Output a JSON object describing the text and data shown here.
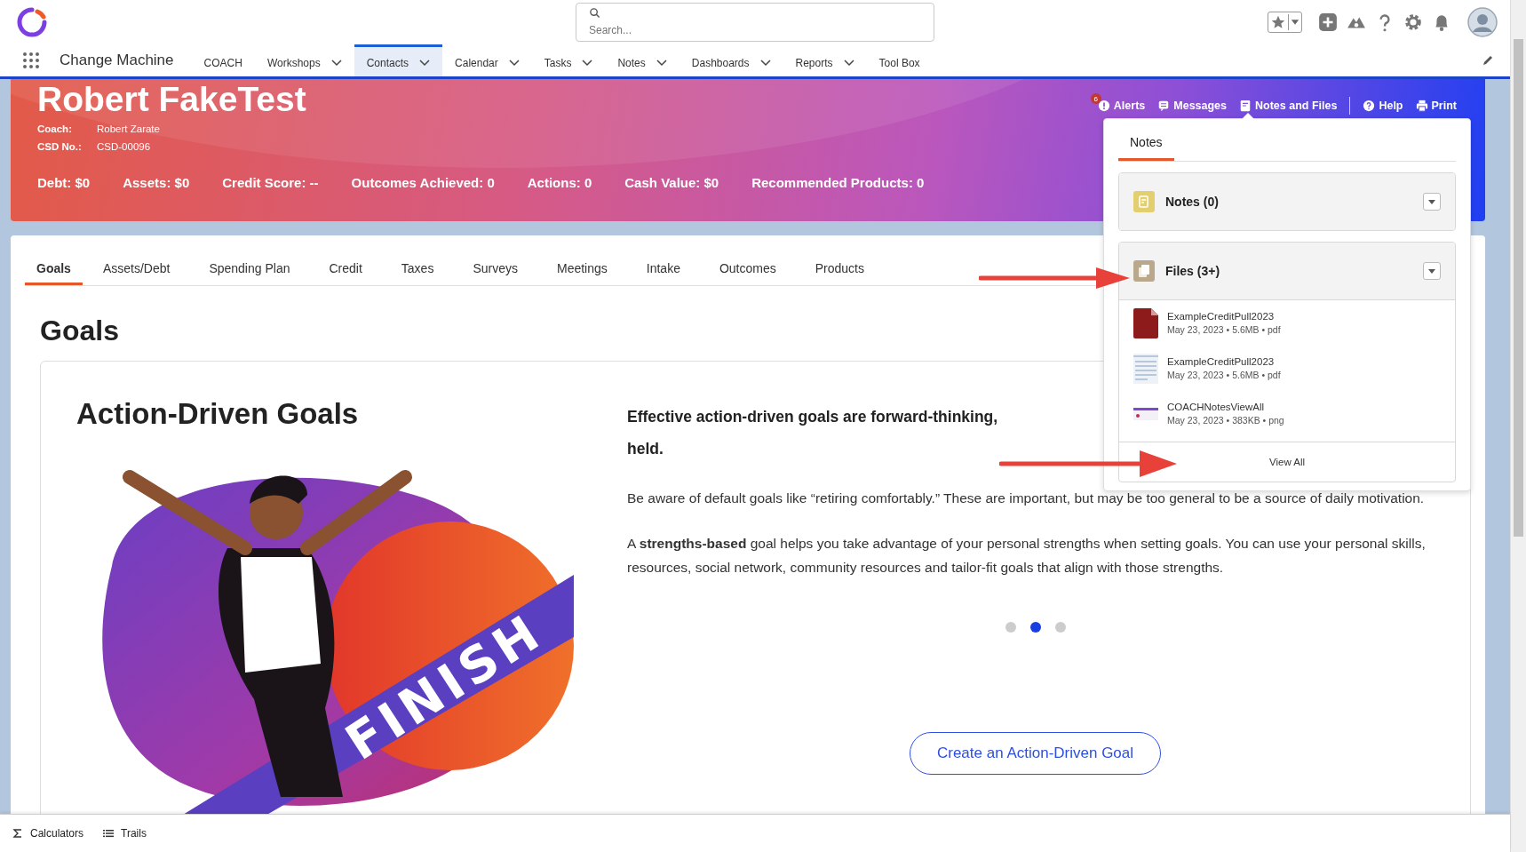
{
  "app": {
    "name": "Change Machine"
  },
  "search": {
    "placeholder": "Search..."
  },
  "nav": [
    {
      "label": "COACH",
      "has_menu": false,
      "selected": false
    },
    {
      "label": "Workshops",
      "has_menu": true,
      "selected": false
    },
    {
      "label": "Contacts",
      "has_menu": true,
      "selected": true
    },
    {
      "label": "Calendar",
      "has_menu": true,
      "selected": false
    },
    {
      "label": "Tasks",
      "has_menu": true,
      "selected": false
    },
    {
      "label": "Notes",
      "has_menu": true,
      "selected": false
    },
    {
      "label": "Dashboards",
      "has_menu": true,
      "selected": false
    },
    {
      "label": "Reports",
      "has_menu": true,
      "selected": false
    },
    {
      "label": "Tool Box",
      "has_menu": false,
      "selected": false
    }
  ],
  "record": {
    "name": "Robert FakeTest",
    "fields": [
      {
        "label": "Coach:",
        "value": "Robert Zarate"
      },
      {
        "label": "CSD No.:",
        "value": "CSD-00096"
      }
    ],
    "stats": [
      "Debt: $0",
      "Assets: $0",
      "Credit Score: --",
      "Outcomes Achieved: 0",
      "Actions: 0",
      "Cash Value: $0",
      "Recommended Products: 0"
    ]
  },
  "record_actions": [
    {
      "kind": "alerts",
      "label": "Alerts",
      "badge": "6",
      "selected": false
    },
    {
      "kind": "messages",
      "label": "Messages",
      "selected": false
    },
    {
      "kind": "notes",
      "label": "Notes and Files",
      "selected": true
    },
    {
      "kind": "help",
      "label": "Help",
      "selected": false
    },
    {
      "kind": "print",
      "label": "Print",
      "selected": false
    }
  ],
  "popup": {
    "tabs": [
      {
        "label": "Notes",
        "selected": true
      }
    ],
    "sections": [
      {
        "kind": "notes",
        "title": "Notes (0)"
      },
      {
        "kind": "files",
        "title": "Files (3+)",
        "files": [
          {
            "kind": "pdf",
            "name": "ExampleCreditPull2023",
            "meta": "May 23, 2023 • 5.6MB • pdf"
          },
          {
            "kind": "document",
            "name": "ExampleCreditPull2023",
            "meta": "May 23, 2023 • 5.6MB • pdf"
          },
          {
            "kind": "image",
            "name": "COACHNotesViewAll",
            "meta": "May 23, 2023 • 383KB • png"
          }
        ]
      }
    ],
    "view_all": "View All"
  },
  "tabs": [
    {
      "label": "Goals",
      "selected": true
    },
    {
      "label": "Assets/Debt",
      "selected": false
    },
    {
      "label": "Spending Plan",
      "selected": false
    },
    {
      "label": "Credit",
      "selected": false
    },
    {
      "label": "Taxes",
      "selected": false
    },
    {
      "label": "Surveys",
      "selected": false
    },
    {
      "label": "Meetings",
      "selected": false
    },
    {
      "label": "Intake",
      "selected": false
    },
    {
      "label": "Outcomes",
      "selected": false
    },
    {
      "label": "Products",
      "selected": false
    }
  ],
  "page_title": "Goals",
  "goal_card": {
    "title": "Action-Driven Goals",
    "ribbon": "FINISH",
    "lead": [
      "Effective action-driven goals are forward-thinking,",
      "held."
    ],
    "paragraphs": [
      "Be aware of default goals like “retiring comfortably.” These are important, but may be too general to be a source of daily motivation.",
      "A **strengths-based** goal helps you take advantage of your personal strengths when setting goals. You can use your personal skills, resources, social network, community resources and tailor-fit goals that align with those strengths."
    ],
    "dots": [
      {
        "selected": false
      },
      {
        "selected": true
      },
      {
        "selected": false
      }
    ],
    "button": "Create an Action-Driven Goal"
  },
  "utility_bar": [
    {
      "kind": "calculators",
      "label": "Calculators"
    },
    {
      "kind": "trails",
      "label": "Trails"
    }
  ]
}
